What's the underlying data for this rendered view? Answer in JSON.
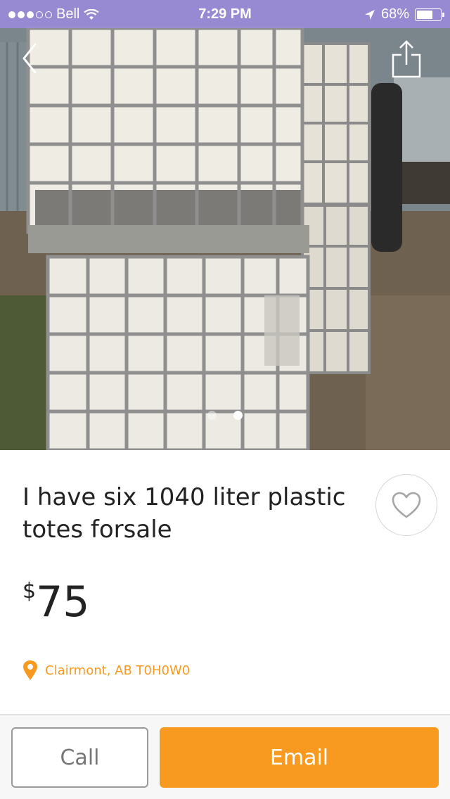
{
  "status_bar": {
    "carrier": "Bell",
    "time": "7:29 PM",
    "battery": "68%",
    "battery_level": 0.68
  },
  "gallery": {
    "image_count": 2,
    "active_index": 1
  },
  "listing": {
    "title": "I have six 1040 liter plastic totes forsale",
    "currency_symbol": "$",
    "price": "75",
    "location": "Clairmont, AB T0H0W0"
  },
  "actions": {
    "call_label": "Call",
    "email_label": "Email"
  },
  "colors": {
    "accent": "#f79a1f",
    "status_bar": "#a08ce6"
  },
  "icons": {
    "back": "chevron-left-icon",
    "share": "share-icon",
    "favorite": "heart-icon",
    "location": "location-pin-icon"
  }
}
